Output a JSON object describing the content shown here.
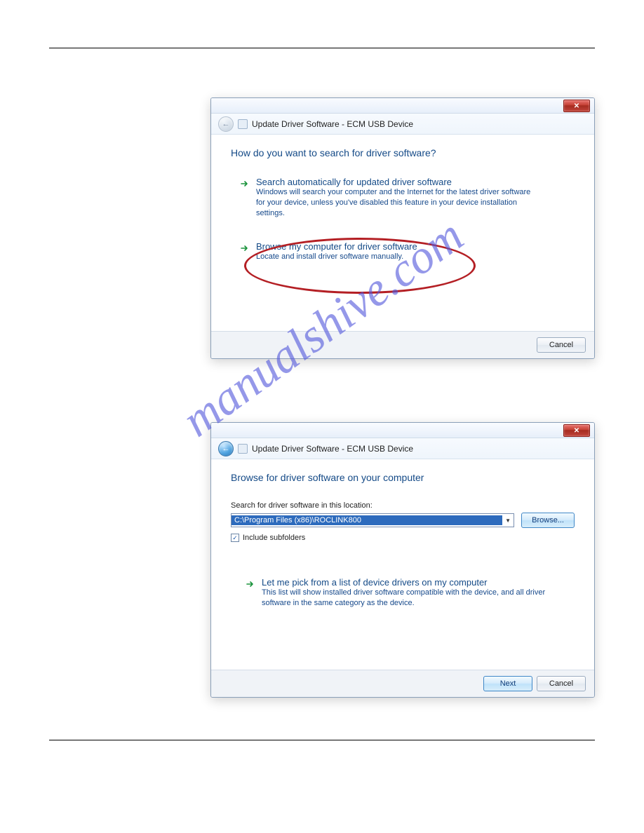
{
  "watermark": "manualshive.com",
  "dialog1": {
    "nav_title": "Update Driver Software - ECM USB Device",
    "heading": "How do you want to search for driver software?",
    "opt_auto": {
      "title": "Search automatically for updated driver software",
      "desc": "Windows will search your computer and the Internet for the latest driver software for your device, unless you've disabled this feature in your device installation settings."
    },
    "opt_browse": {
      "title": "Browse my computer for driver software",
      "desc": "Locate and install driver software manually."
    },
    "cancel": "Cancel"
  },
  "dialog2": {
    "nav_title": "Update Driver Software - ECM USB Device",
    "heading": "Browse for driver software on your computer",
    "search_label": "Search for driver software in this location:",
    "path_value": "C:\\Program Files (x86)\\ROCLINK800",
    "browse_btn": "Browse...",
    "include_subfolders": "Include subfolders",
    "opt_pick": {
      "title": "Let me pick from a list of device drivers on my computer",
      "desc": "This list will show installed driver software compatible with the device, and all driver software in the same category as the device."
    },
    "next": "Next",
    "cancel": "Cancel"
  }
}
